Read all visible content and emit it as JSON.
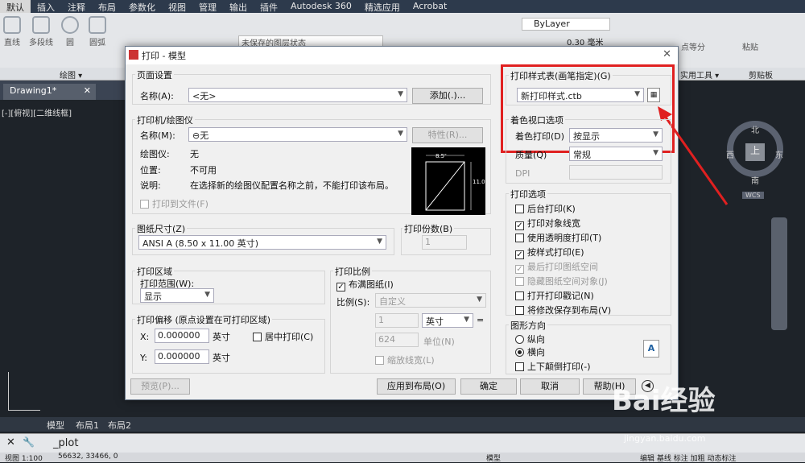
{
  "menubar": [
    "默认",
    "插入",
    "注释",
    "布局",
    "参数化",
    "视图",
    "管理",
    "输出",
    "插件",
    "Autodesk 360",
    "精选应用",
    "Acrobat"
  ],
  "ribbon": {
    "tools": [
      "直线",
      "多段线",
      "圆",
      "圆弧"
    ],
    "layer_state": "未保存的图层状态",
    "bylayer": "ByLayer",
    "lineweight": "0.30 毫米",
    "right_tools": [
      "点等分",
      "粘贴"
    ],
    "panels": [
      "绘图 ▾",
      "实用工具 ▾",
      "剪贴板"
    ]
  },
  "doc_tab": "Drawing1*",
  "view_label": "[-][俯视][二维线框]",
  "compass": {
    "n": "北",
    "s": "南",
    "e": "东",
    "w": "西",
    "up": "上",
    "wcs": "WCS"
  },
  "dialog": {
    "title": "打印 - 模型",
    "page_setup": {
      "title": "页面设置",
      "name_label": "名称(A):",
      "name_value": "<无>",
      "add_button": "添加(.)..."
    },
    "plotter": {
      "title": "打印机/绘图仪",
      "name_label": "名称(M):",
      "name_value": "⊖无",
      "props_button": "特性(R)...",
      "plotter_label": "绘图仪:",
      "plotter_value": "无",
      "location_label": "位置:",
      "location_value": "不可用",
      "desc_label": "说明:",
      "desc_value": "在选择新的绘图仪配置名称之前，不能打印该布局。",
      "plot_to_file": "打印到文件(F)",
      "dim_w": "8.5″",
      "dim_h": "11.0″"
    },
    "paper_size": {
      "title": "图纸尺寸(Z)",
      "value": "ANSI A (8.50 x 11.00 英寸)"
    },
    "copies": {
      "title": "打印份数(B)",
      "value": "1"
    },
    "plot_area": {
      "title": "打印区域",
      "range_label": "打印范围(W):",
      "range_value": "显示"
    },
    "plot_offset": {
      "title": "打印偏移 (原点设置在可打印区域)",
      "x_label": "X:",
      "x_value": "0.000000",
      "y_label": "Y:",
      "y_value": "0.000000",
      "unit": "英寸",
      "center": "居中打印(C)"
    },
    "plot_scale": {
      "title": "打印比例",
      "fit": "布满图纸(I)",
      "scale_label": "比例(S):",
      "scale_value": "自定义",
      "v1": "1",
      "unit": "英寸",
      "v2": "624",
      "unit2": "单位(N)",
      "scale_lw": "缩放线宽(L)"
    },
    "style_table": {
      "title": "打印样式表(画笔指定)(G)",
      "value": "新打印样式.ctb"
    },
    "shaded": {
      "title": "着色视口选项",
      "shade_label": "着色打印(D)",
      "shade_value": "按显示",
      "quality_label": "质量(Q)",
      "quality_value": "常规",
      "dpi_label": "DPI"
    },
    "options": {
      "title": "打印选项",
      "items": [
        {
          "label": "后台打印(K)",
          "checked": false,
          "enabled": true
        },
        {
          "label": "打印对象线宽",
          "checked": true,
          "enabled": true
        },
        {
          "label": "使用透明度打印(T)",
          "checked": false,
          "enabled": true
        },
        {
          "label": "按样式打印(E)",
          "checked": true,
          "enabled": true
        },
        {
          "label": "最后打印图纸空间",
          "checked": true,
          "enabled": false
        },
        {
          "label": "隐藏图纸空间对象(J)",
          "checked": false,
          "enabled": false
        },
        {
          "label": "打开打印戳记(N)",
          "checked": false,
          "enabled": true
        },
        {
          "label": "将修改保存到布局(V)",
          "checked": false,
          "enabled": true
        }
      ]
    },
    "orientation": {
      "title": "图形方向",
      "portrait": "纵向",
      "landscape": "横向",
      "upside": "上下颠倒打印(-)",
      "selected": "landscape"
    },
    "buttons": {
      "preview": "预览(P)...",
      "apply": "应用到布局(O)",
      "ok": "确定",
      "cancel": "取消",
      "help": "帮助(H)"
    }
  },
  "layout_tabs": [
    "模型",
    "布局1",
    "布局2"
  ],
  "command": "_plot",
  "status": {
    "scale": "视图 1:100",
    "coords": "56632, 33466, 0",
    "model": "模型",
    "right": "编辑 基线 标注 加粗 动态标注"
  },
  "watermark": {
    "brand": "Bai经验",
    "url": "jingyan.baidu.com"
  },
  "colors": {
    "highlight": "#e02020",
    "dialog_bg": "#f0f0f0",
    "canvas": "#1e2329"
  }
}
